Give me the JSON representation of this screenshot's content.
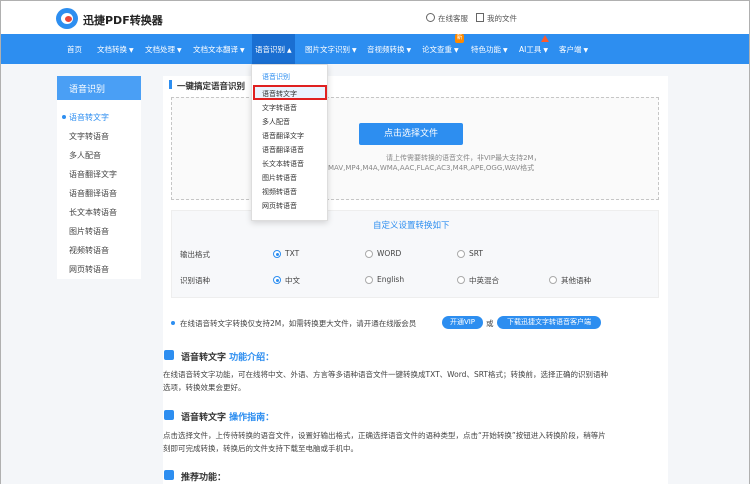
{
  "header": {
    "brand": "迅捷PDF转换器",
    "service": "在线客服",
    "my_files": "我的文件"
  },
  "nav": {
    "items": [
      "首页",
      "文档转换",
      "文档处理",
      "文档文本翻译",
      "语音识别",
      "图片文字识别",
      "音视频转换",
      "论文查重",
      "特色功能",
      "AI工具",
      "客户端"
    ],
    "badge": "新"
  },
  "dropdown": {
    "header": "语音识别",
    "items": [
      "语音转文字",
      "文字转语音",
      "多人配音",
      "语音翻译文字",
      "语音翻译语音",
      "长文本转语音",
      "图片转语音",
      "视频转语音",
      "网页转语音"
    ]
  },
  "sidebar": {
    "title": "语音识别",
    "items": [
      "语音转文字",
      "文字转语音",
      "多人配音",
      "语音翻译文字",
      "语音翻译语音",
      "长文本转语音",
      "图片转语音",
      "视频转语音",
      "网页转语音"
    ]
  },
  "main": {
    "section_title": "一键搞定语音识别",
    "upload_button": "点击选择文件",
    "hint1": "请上传需要转换的语音文件，非VIP最大支持2M，",
    "hint2": "MAV,MP4,M4A,WMA,AAC,FLAC,AC3,M4R,APE,OGG,WAV格式",
    "settings_title": "自定义设置转换如下",
    "output_label": "输出格式",
    "output_options": [
      "TXT",
      "WORD",
      "SRT"
    ],
    "lang_label": "识别语种",
    "lang_options": [
      "中文",
      "English",
      "中英混合",
      "其他语种"
    ],
    "note": "在线语音转文字转换仅支持2M，如需转换更大文件，请开通在线版会员",
    "vip_button": "开通VIP",
    "or": "或",
    "download_button": "下载迅捷文字转语音客户端",
    "intro_title_main": "语音转文字",
    "intro_title_sub": " 功能介绍：",
    "intro_line1": "在线语音转文字功能，可在线将中文、外语、方言等多语种语音文件一键转换成TXT、Word、SRT格式；转换前，选择正确的识别语种",
    "intro_line2": "选项，转换效果会更好。",
    "guide_title_main": "语音转文字",
    "guide_title_sub": " 操作指南：",
    "guide_line1": "点击选择文件，上传待转换的语音文件，设置好输出格式，正确选择语音文件的语种类型，点击“开始转换”按钮进入转换阶段，稍等片",
    "guide_line2": "刻即可完成转换，转换后的文件支持下载至电脑或手机中。",
    "recommend_title": "推荐功能："
  },
  "colors": {
    "primary": "#2d8ef0",
    "highlight": "#e02020"
  }
}
